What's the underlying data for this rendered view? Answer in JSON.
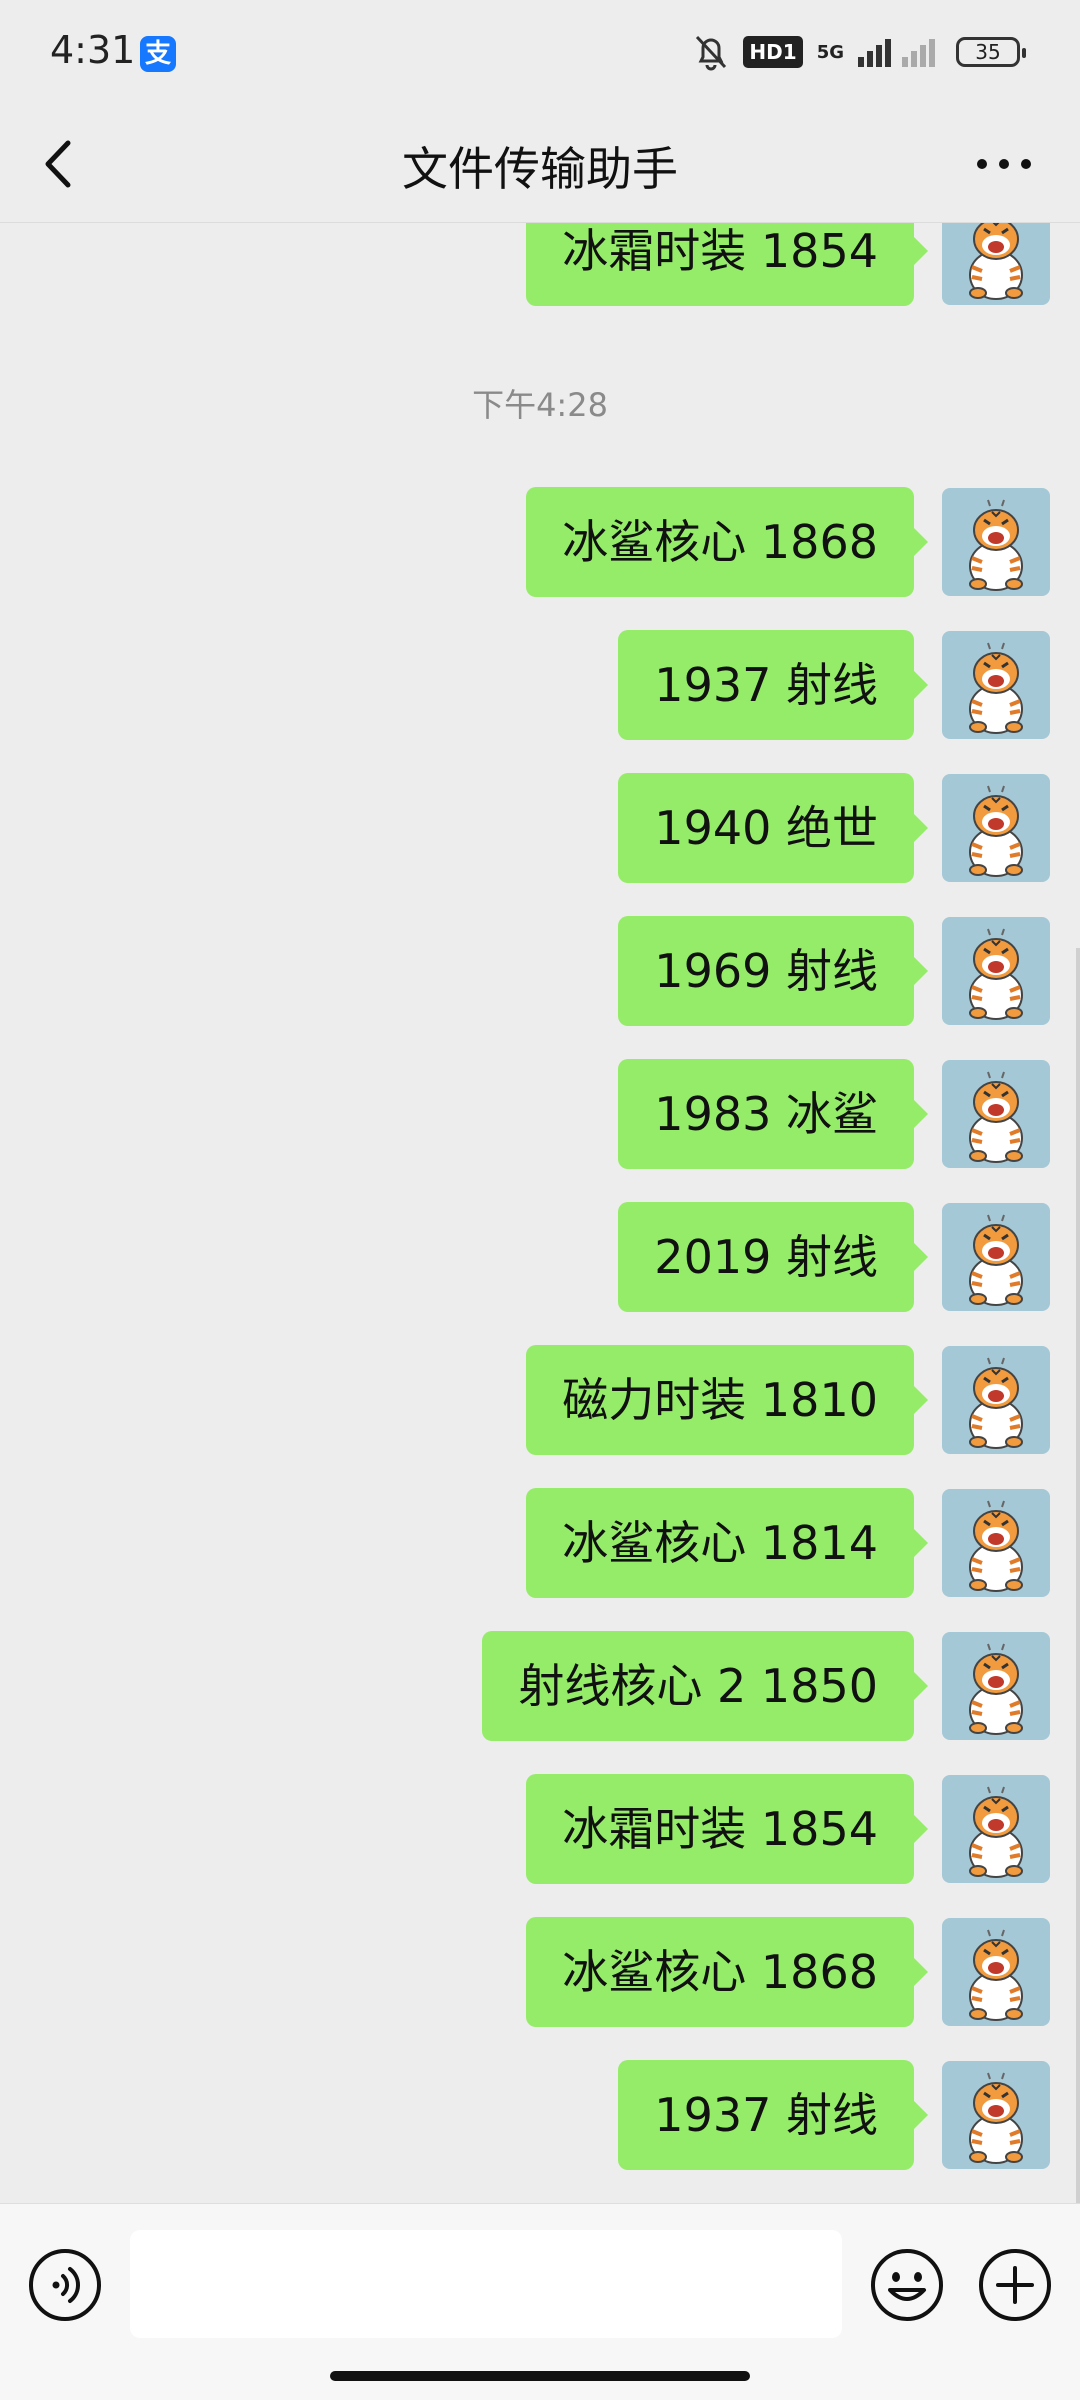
{
  "status_bar": {
    "time": "4:31",
    "alipay_icon_glyph": "支",
    "hd_badge": "HD1",
    "network": "5G",
    "battery": "35"
  },
  "header": {
    "title": "文件传输助手"
  },
  "chat": {
    "timestamp": "下午4:28",
    "partial_message": "冰霜时装 1854",
    "messages": [
      "冰鲨核心 1868",
      "1937 射线",
      "1940 绝世",
      "1969 射线",
      "1983 冰鲨",
      "2019 射线",
      "磁力时装 1810",
      "冰鲨核心 1814",
      "射线核心 2 1850",
      "冰霜时装 1854",
      "冰鲨核心 1868",
      "1937 射线"
    ]
  },
  "input_bar": {
    "text_value": "",
    "placeholder": ""
  },
  "colors": {
    "background": "#ededed",
    "bubble_green": "#95ec69",
    "avatar_bg": "#a4c8d6",
    "alipay_blue": "#1677ff"
  },
  "icons": {
    "back": "chevron-left-icon",
    "more": "more-dots-icon",
    "voice": "voice-icon",
    "emoji": "emoji-icon",
    "plus": "plus-icon",
    "mute": "bell-off-icon",
    "signal": "signal-icon",
    "battery": "battery-icon"
  }
}
